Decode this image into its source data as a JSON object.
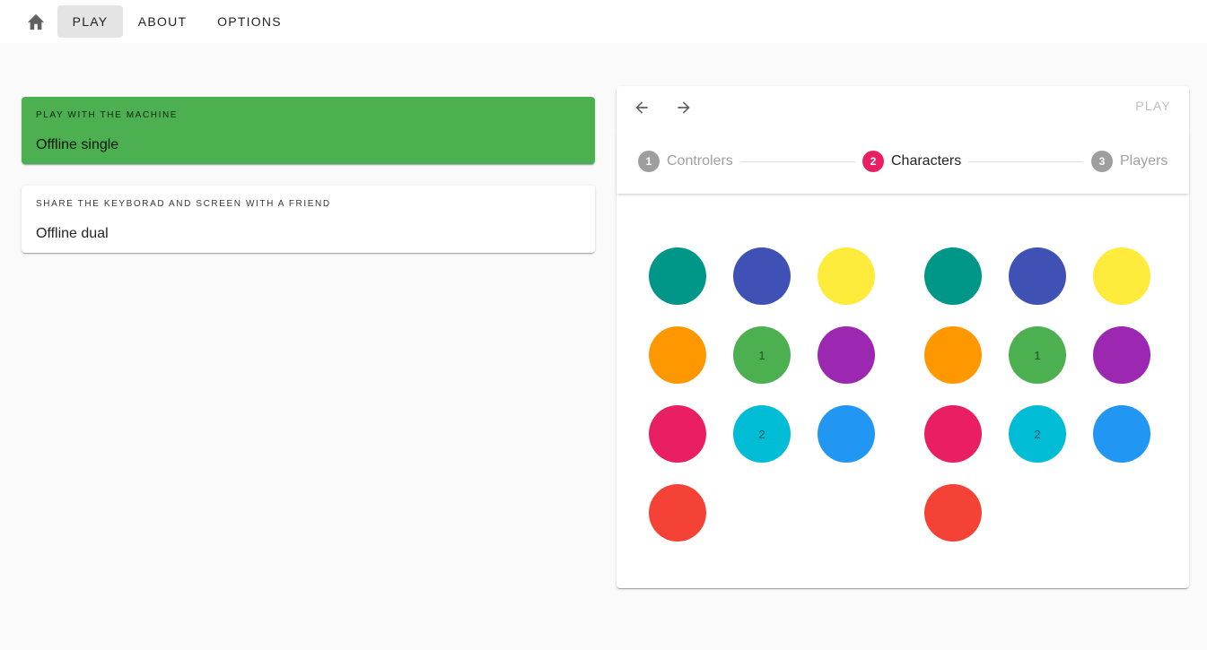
{
  "nav": {
    "home_icon": "home-icon",
    "items": [
      {
        "label": "PLAY",
        "active": true
      },
      {
        "label": "ABOUT",
        "active": false
      },
      {
        "label": "OPTIONS",
        "active": false
      }
    ]
  },
  "modes": [
    {
      "overline": "PLAY WITH THE MACHINE",
      "title": "Offline single",
      "selected": true
    },
    {
      "overline": "SHARE THE KEYBORAD AND SCREEN WITH A FRIEND",
      "title": "Offline dual",
      "selected": false
    }
  ],
  "stepper_toolbar": {
    "back_icon": "arrow-left-icon",
    "forward_icon": "arrow-right-icon",
    "play_label": "PLAY"
  },
  "steps": [
    {
      "number": "1",
      "label": "Controlers",
      "active": false
    },
    {
      "number": "2",
      "label": "Characters",
      "active": true
    },
    {
      "number": "3",
      "label": "Players",
      "active": false
    }
  ],
  "character_grids": [
    {
      "characters": [
        {
          "color": "#009688",
          "label": ""
        },
        {
          "color": "#3f51b5",
          "label": ""
        },
        {
          "color": "#ffeb3b",
          "label": ""
        },
        {
          "color": "#ff9800",
          "label": ""
        },
        {
          "color": "#4caf50",
          "label": "1"
        },
        {
          "color": "#9c27b0",
          "label": ""
        },
        {
          "color": "#e91e63",
          "label": ""
        },
        {
          "color": "#00bcd4",
          "label": "2"
        },
        {
          "color": "#2196f3",
          "label": ""
        },
        {
          "color": "#f44336",
          "label": ""
        }
      ]
    },
    {
      "characters": [
        {
          "color": "#009688",
          "label": ""
        },
        {
          "color": "#3f51b5",
          "label": ""
        },
        {
          "color": "#ffeb3b",
          "label": ""
        },
        {
          "color": "#ff9800",
          "label": ""
        },
        {
          "color": "#4caf50",
          "label": "1"
        },
        {
          "color": "#9c27b0",
          "label": ""
        },
        {
          "color": "#e91e63",
          "label": ""
        },
        {
          "color": "#00bcd4",
          "label": "2"
        },
        {
          "color": "#2196f3",
          "label": ""
        },
        {
          "color": "#f44336",
          "label": ""
        }
      ]
    }
  ]
}
